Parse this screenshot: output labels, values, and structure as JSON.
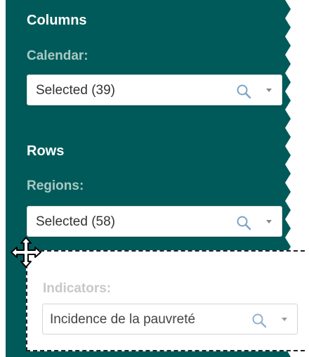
{
  "colors": {
    "panel_bg": "#005a5a",
    "title_text": "#ffffff",
    "label_text": "#a9c9c4",
    "drag_label_text": "#c8c8c8"
  },
  "columns": {
    "title": "Columns",
    "field_label": "Calendar:",
    "selected_value": "Selected (39)",
    "search_icon": "search-icon",
    "dropdown_icon": "chevron-down-icon"
  },
  "rows": {
    "title": "Rows",
    "field_label": "Regions:",
    "selected_value": "Selected (58)",
    "search_icon": "search-icon",
    "dropdown_icon": "chevron-down-icon"
  },
  "dragging": {
    "field_label": "Indicators:",
    "selected_value": "Incidence de la pauvreté",
    "handle_icon": "move-icon"
  }
}
